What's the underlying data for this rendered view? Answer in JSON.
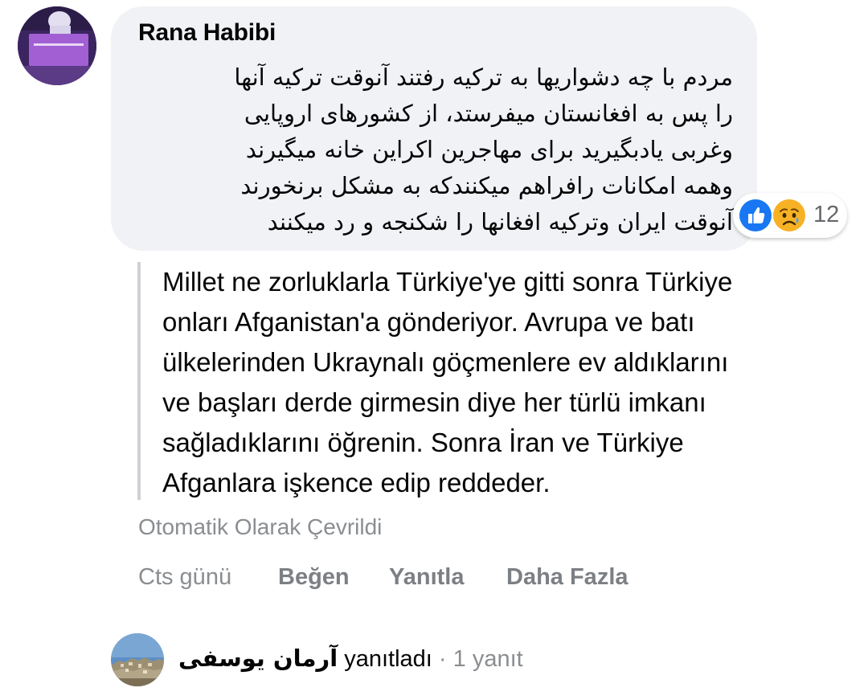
{
  "comment": {
    "author": "Rana Habibi",
    "text": "مردم با چه دشواریها به ترکیه رفتند آنوقت ترکیه آنها\nرا پس به افغانستان میفرستد، از کشورهای اروپایی\nوغربی یادبگیرید برای مهاجرین اکراین خانه میگیرند\nوهمه امکانات رافراهم میکنندکه به مشکل برنخورند\nآنوقت ایران وترکیه افغانها را شکنجه و رد میکنند",
    "reactions": {
      "icons": [
        "like-icon",
        "sad-icon"
      ],
      "count": "12",
      "colors": {
        "like": "#1877f2",
        "sad": "#f7b125"
      }
    },
    "translation": {
      "text": "Millet ne zorluklarla Türkiye'ye gitti sonra Türkiye\nonları Afganistan'a gönderiyor. Avrupa ve batı\nülkelerinden Ukraynalı göçmenlere ev aldıklarını\nve başları derde girmesin diye her türlü imkanı\nsağladıklarını öğrenin. Sonra İran ve Türkiye\nAfganlara işkence edip reddeder.",
      "label": "Otomatik Olarak Çevrildi"
    },
    "actions": {
      "time": "Cts günü",
      "like": "Beğen",
      "reply": "Yanıtla",
      "more": "Daha Fazla"
    }
  },
  "reply": {
    "name": "آرمان یوسفی",
    "verb": "yanıtladı",
    "separator": "·",
    "count": "1 yanıt"
  },
  "colors": {
    "bubble": "#f0f2f5",
    "secondary_text": "#8a8d91",
    "primary_text": "#050505"
  }
}
